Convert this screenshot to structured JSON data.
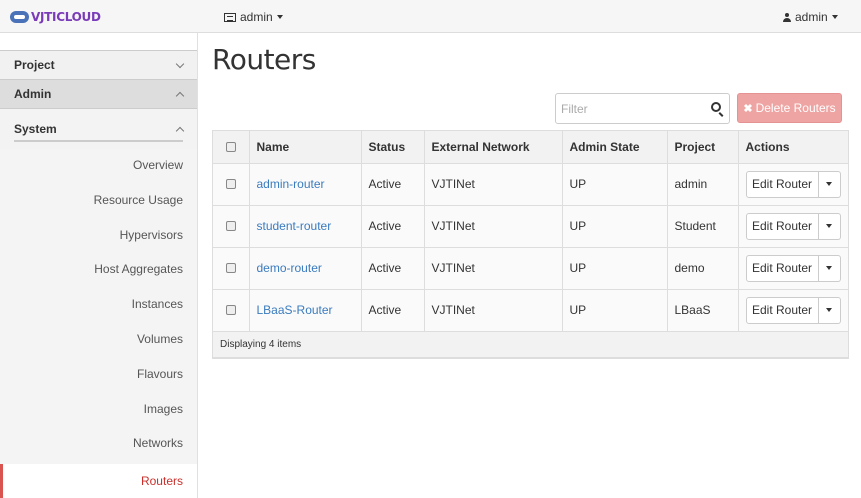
{
  "app": {
    "logo_text": "VJTICLOUD"
  },
  "topbar": {
    "project_label": "admin",
    "user_label": "admin"
  },
  "sidebar": {
    "project": "Project",
    "admin": "Admin",
    "system": "System",
    "items": [
      "Overview",
      "Resource Usage",
      "Hypervisors",
      "Host Aggregates",
      "Instances",
      "Volumes",
      "Flavours",
      "Images",
      "Networks",
      "Routers"
    ],
    "active": "Routers"
  },
  "page": {
    "title": "Routers"
  },
  "filter": {
    "placeholder": "Filter"
  },
  "delete_button": "Delete Routers",
  "table": {
    "headers": [
      "Name",
      "Status",
      "External Network",
      "Admin State",
      "Project",
      "Actions"
    ],
    "rows": [
      {
        "name": "admin-router",
        "status": "Active",
        "ext_net": "VJTINet",
        "admin_state": "UP",
        "project": "admin",
        "action": "Edit Router"
      },
      {
        "name": "student-router",
        "status": "Active",
        "ext_net": "VJTINet",
        "admin_state": "UP",
        "project": "Student",
        "action": "Edit Router"
      },
      {
        "name": "demo-router",
        "status": "Active",
        "ext_net": "VJTINet",
        "admin_state": "UP",
        "project": "demo",
        "action": "Edit Router"
      },
      {
        "name": "LBaaS-Router",
        "status": "Active",
        "ext_net": "VJTINet",
        "admin_state": "UP",
        "project": "LBaaS",
        "action": "Edit Router"
      }
    ],
    "footer": "Displaying 4 items"
  },
  "colors": {
    "accent_active": "#d9534f",
    "link": "#3a7bbf",
    "danger_button": "#eea4a2"
  }
}
